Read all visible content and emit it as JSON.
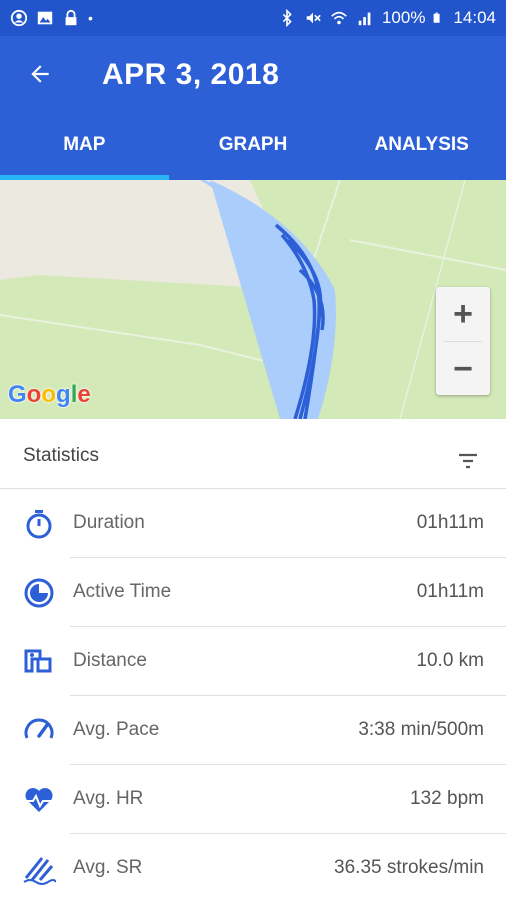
{
  "status_bar": {
    "battery": "100%",
    "time": "14:04"
  },
  "app_bar": {
    "title": "APR 3, 2018"
  },
  "tabs": [
    {
      "label": "MAP",
      "active": true
    },
    {
      "label": "GRAPH",
      "active": false
    },
    {
      "label": "ANALYSIS",
      "active": false
    }
  ],
  "map": {
    "zoom_in": "+",
    "zoom_out": "−",
    "attribution": "Google"
  },
  "stats": {
    "title": "Statistics",
    "rows": [
      {
        "label": "Duration",
        "value": "01h11m",
        "icon": "stopwatch-icon"
      },
      {
        "label": "Active Time",
        "value": "01h11m",
        "icon": "active-time-icon"
      },
      {
        "label": "Distance",
        "value": "10.0 km",
        "icon": "distance-icon"
      },
      {
        "label": "Avg. Pace",
        "value": "3:38 min/500m",
        "icon": "speedometer-icon"
      },
      {
        "label": "Avg. HR",
        "value": "132 bpm",
        "icon": "heart-rate-icon"
      },
      {
        "label": "Avg. SR",
        "value": "36.35 strokes/min",
        "icon": "stroke-rate-icon"
      }
    ]
  },
  "colors": {
    "primary": "#2d5fd6",
    "status_bar": "#2255cc",
    "tab_indicator": "#29b6f6",
    "icon": "#2d5fd6"
  }
}
